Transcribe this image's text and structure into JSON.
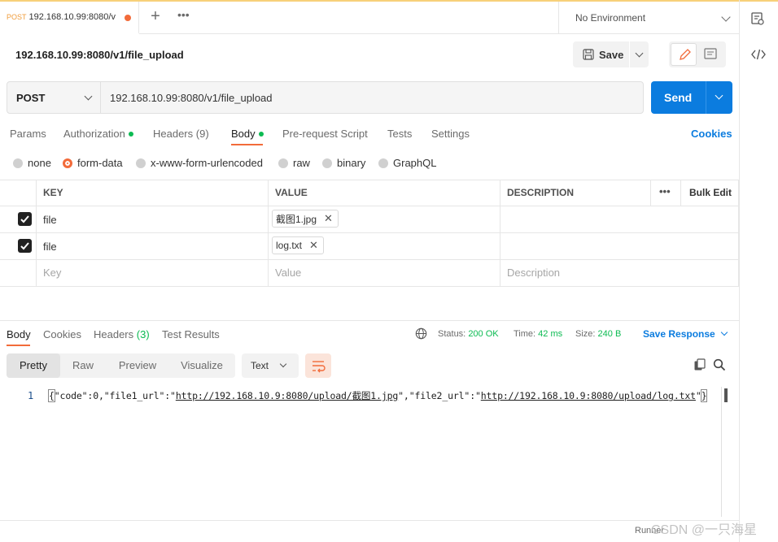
{
  "tabs": [
    {
      "method": "POST",
      "url": "192.168.10.99:8080/v"
    }
  ],
  "toolbar": {
    "plus": "+",
    "more": "•••"
  },
  "environment": {
    "label": "No Environment"
  },
  "request": {
    "title": "192.168.10.99:8080/v1/file_upload",
    "save_label": "Save",
    "method": "POST",
    "url": "192.168.10.99:8080/v1/file_upload",
    "send_label": "Send"
  },
  "request_tabs": [
    {
      "label": "Params"
    },
    {
      "label": "Authorization",
      "dot": true
    },
    {
      "label": "Headers",
      "count": "(9)"
    },
    {
      "label": "Body",
      "dot": true,
      "active": true
    },
    {
      "label": "Pre-request Script"
    },
    {
      "label": "Tests"
    },
    {
      "label": "Settings"
    }
  ],
  "cookies_label": "Cookies",
  "body_types": [
    "none",
    "form-data",
    "x-www-form-urlencoded",
    "raw",
    "binary",
    "GraphQL"
  ],
  "selected_body_type": "form-data",
  "params_table": {
    "headers": [
      "KEY",
      "VALUE",
      "DESCRIPTION"
    ],
    "bulk_edit": "Bulk Edit",
    "rows": [
      {
        "checked": true,
        "key": "file",
        "value": "截图1.jpg"
      },
      {
        "checked": true,
        "key": "file",
        "value": "log.txt"
      }
    ],
    "placeholders": {
      "key": "Key",
      "value": "Value",
      "description": "Description"
    }
  },
  "response": {
    "tabs": [
      {
        "label": "Body",
        "active": true
      },
      {
        "label": "Cookies"
      },
      {
        "label": "Headers",
        "count": "(3)"
      },
      {
        "label": "Test Results"
      }
    ],
    "status_label": "Status:",
    "status_value": "200 OK",
    "time_label": "Time:",
    "time_value": "42 ms",
    "size_label": "Size:",
    "size_value": "240 B",
    "save_response": "Save Response",
    "views": [
      "Pretty",
      "Raw",
      "Preview",
      "Visualize"
    ],
    "active_view": "Pretty",
    "format": "Text",
    "line_number": "1",
    "code": {
      "p1": "\"code\":0,\"file1_url\":\"",
      "link1": "http://192.168.10.9:8080/upload/截图1.jpg",
      "p2": "\",\"file2_url\":\"",
      "link2": "http://192.168.10.9:8080/upload/log.txt",
      "p3": "\""
    }
  },
  "footer": {
    "runner": "Runner"
  },
  "watermark": "CSDN @一只海星",
  "colors": {
    "accent": "#f26b3a",
    "send": "#0b7cdf",
    "success": "#0cbb52"
  }
}
